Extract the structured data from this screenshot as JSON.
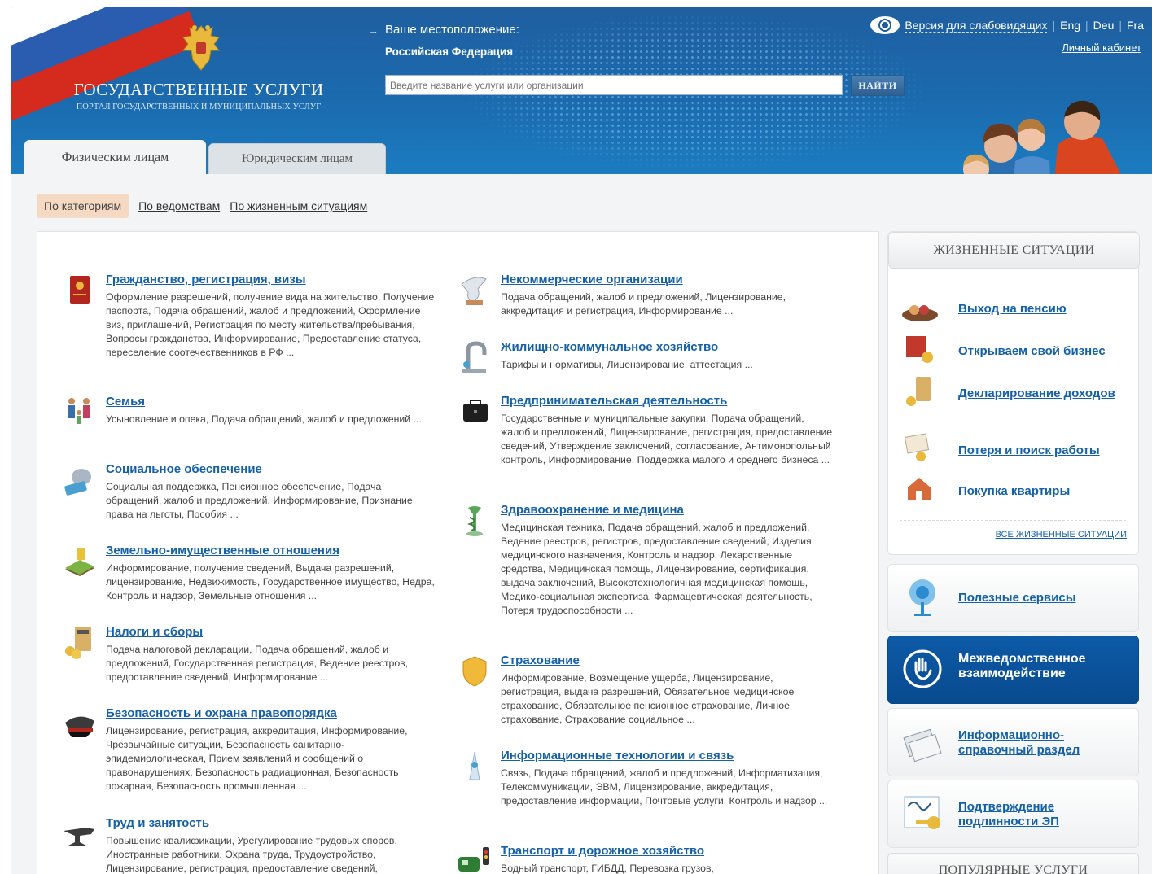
{
  "header": {
    "brand_title": "ГОСУДАРСТВЕННЫЕ УСЛУГИ",
    "brand_subtitle": "ПОРТАЛ ГОСУДАРСТВЕННЫХ И МУНИЦИПАЛЬНЫХ УСЛУГ",
    "location_label": "Ваше местоположение:",
    "location_value": "Российская Федерация",
    "search_placeholder": "Введите название услуги или организации",
    "search_button": "НАЙТИ",
    "accessibility_link": "Версия для слабовидящих",
    "lang_eng": "Eng",
    "lang_deu": "Deu",
    "lang_fra": "Fra",
    "cabinet_link": "Личный кабинет"
  },
  "tabs": {
    "individuals": "Физическим лицам",
    "legal": "Юридическим лицам"
  },
  "subtabs": {
    "by_category": "По категориям",
    "by_agency": "По ведомствам",
    "by_life": "По жизненным ситуациям"
  },
  "categories_left": [
    {
      "title": "Гражданство, регистрация, визы",
      "desc": "Оформление разрешений, получение вида на жительство, Получение паспорта, Подача обращений, жалоб и предложений, Оформление виз, приглашений, Регистрация по месту жительства/пребывания, Вопросы гражданства, Информирование, Предоставление статуса, переселение соотечественников в РФ ..."
    },
    {
      "title": "Семья",
      "desc": "Усыновление и опека, Подача обращений, жалоб и предложений ..."
    },
    {
      "title": "Социальное обеспечение",
      "desc": "Социальная поддержка, Пенсионное обеспечение, Подача обращений, жалоб и предложений, Информирование, Признание права на льготы, Пособия ..."
    },
    {
      "title": "Земельно-имущественные отношения",
      "desc": "Информирование, получение сведений, Выдача разрешений, лицензирование, Недвижимость, Государственное имущество, Недра, Контроль и надзор, Земельные отношения ..."
    },
    {
      "title": "Налоги и сборы",
      "desc": "Подача налоговой декларации, Подача обращений, жалоб и предложений, Государственная регистрация, Ведение реестров, предоставление сведений, Информирование ..."
    },
    {
      "title": "Безопасность и охрана правопорядка",
      "desc": "Лицензирование, регистрация, аккредитация, Информирование, Чрезвычайные ситуации, Безопасность санитарно-эпидемиологическая, Прием заявлений и сообщений о правонарушениях, Безопасность радиационная, Безопасность пожарная, Безопасность промышленная ..."
    },
    {
      "title": "Труд и занятость",
      "desc": "Повышение квалификации, Урегулирование трудовых споров, Иностранные работники, Охрана труда, Трудоустройство, Лицензирование, регистрация, предоставление сведений,"
    }
  ],
  "categories_right": [
    {
      "title": "Некоммерческие организации",
      "desc": "Подача обращений, жалоб и предложений, Лицензирование, аккредитация и регистрация, Информирование ..."
    },
    {
      "title": "Жилищно-коммунальное хозяйство",
      "desc": "Тарифы и нормативы, Лицензирование, аттестация ..."
    },
    {
      "title": "Предпринимательская деятельность",
      "desc": "Государственные и муниципальные закупки, Подача обращений, жалоб и предложений, Лицензирование, регистрация, предоставление сведений, Утверждение заключений, согласование, Антимонопольный контроль, Информирование, Поддержка малого и среднего бизнеса ..."
    },
    {
      "title": "Здравоохранение и медицина",
      "desc": "Медицинская техника, Подача обращений, жалоб и предложений, Ведение реестров, регистров, предоставление сведений, Изделия медицинского назначения, Контроль и надзор, Лекарственные средства, Медицинская помощь, Лицензирование, сертификация, выдача заключений, Высокотехнологичная медицинская помощь, Медико-социальная экспертиза, Фармацевтическая деятельность, Потеря трудоспособности ..."
    },
    {
      "title": "Страхование",
      "desc": "Информирование, Возмещение ущерба, Лицензирование, регистрация, выдача разрешений, Обязательное медицинское страхование, Обязательное пенсионное страхование, Личное страхование, Страхование социальное ..."
    },
    {
      "title": "Информационные технологии и связь",
      "desc": "Связь, Подача обращений, жалоб и предложений, Информатизация, Телекоммуникации, ЭВМ, Лицензирование, аккредитация, предоставление информации, Почтовые услуги, Контроль и надзор ..."
    },
    {
      "title": "Транспорт и дорожное хозяйство",
      "desc": "Водный транспорт, ГИБДД, Перевозка грузов,"
    }
  ],
  "sidebar": {
    "life_title": "ЖИЗНЕННЫЕ СИТУАЦИИ",
    "life_items": [
      "Выход на пенсию",
      "Открываем свой бизнес",
      "Декларирование доходов",
      "Потеря и поиск работы",
      "Покупка квартиры"
    ],
    "life_all": "ВСЕ ЖИЗНЕННЫЕ СИТУАЦИИ",
    "services": [
      "Полезные сервисы",
      "Межведомственное взаимодействие",
      "Информационно-справочный раздел",
      "Подтверждение подлинности ЭП"
    ],
    "popular_title": "ПОПУЛЯРНЫЕ УСЛУГИ"
  },
  "colors": {
    "header_blue": "#1b6aae",
    "link_blue": "#1461a8",
    "active_subtab": "#f5d9c2",
    "interagency_blue": "#0d5aa7"
  }
}
